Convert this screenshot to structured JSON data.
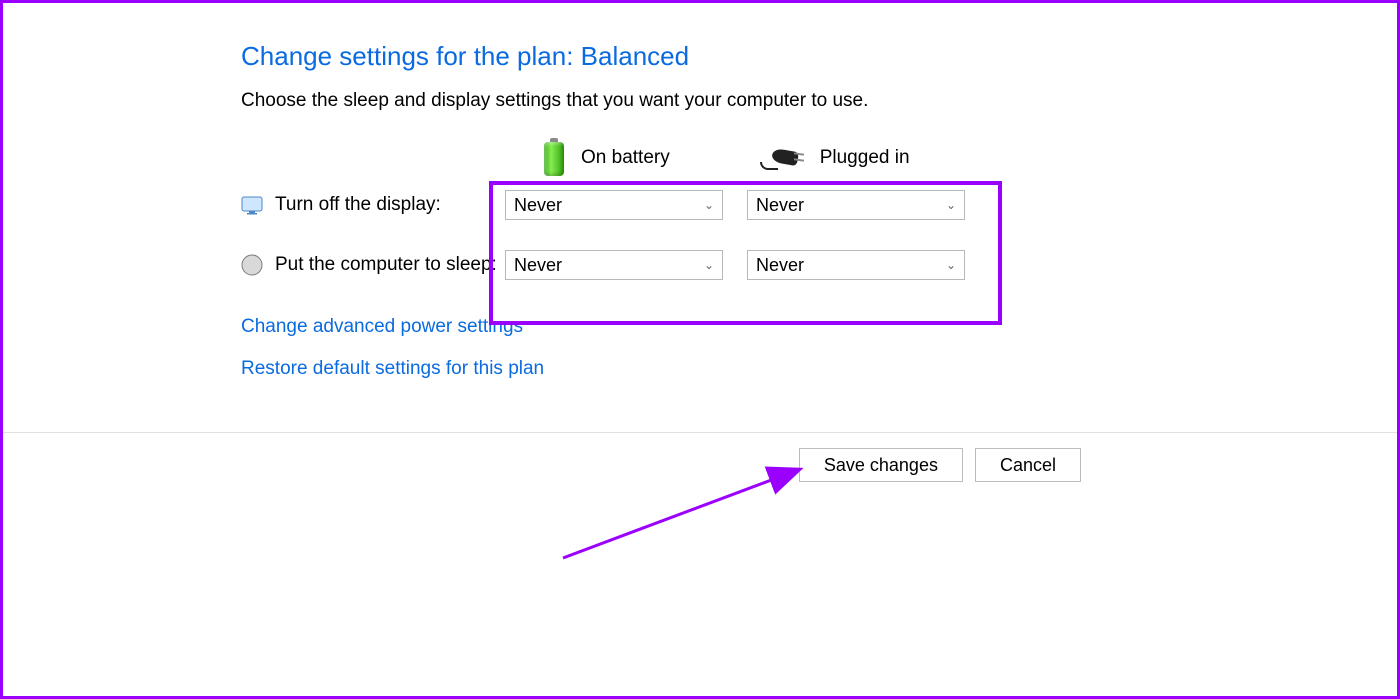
{
  "title": "Change settings for the plan: Balanced",
  "description": "Choose the sleep and display settings that you want your computer to use.",
  "columns": {
    "battery": "On battery",
    "plugged": "Plugged in"
  },
  "rows": {
    "display": {
      "label": "Turn off the display:",
      "battery_value": "Never",
      "plugged_value": "Never"
    },
    "sleep": {
      "label": "Put the computer to sleep:",
      "battery_value": "Never",
      "plugged_value": "Never"
    }
  },
  "links": {
    "advanced": "Change advanced power settings",
    "restore": "Restore default settings for this plan"
  },
  "buttons": {
    "save": "Save changes",
    "cancel": "Cancel"
  }
}
